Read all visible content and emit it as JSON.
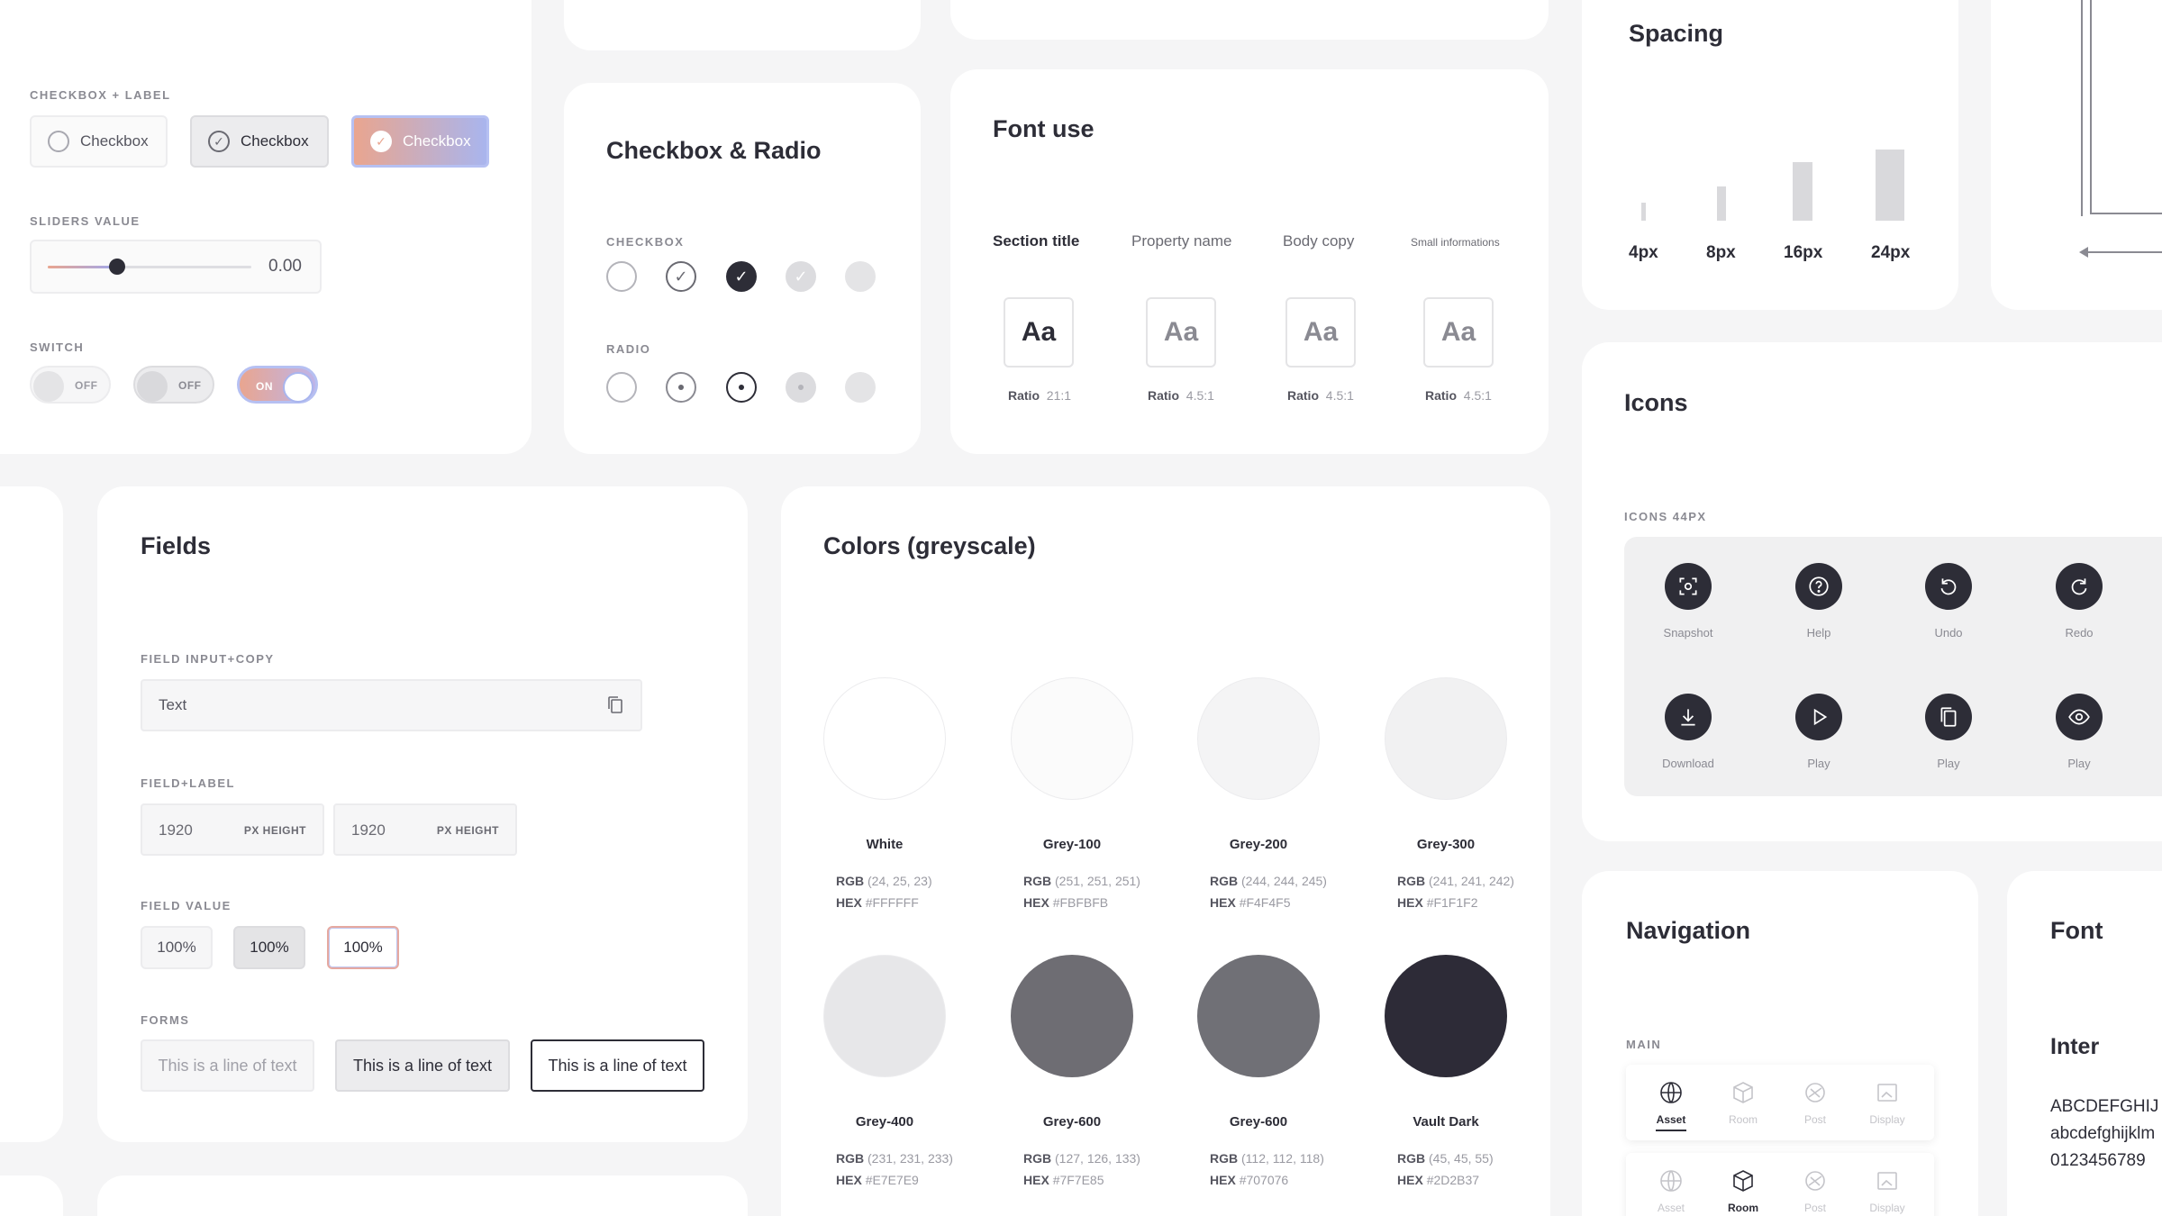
{
  "checkbox_label": {
    "title": "CHECKBOX + LABEL",
    "items": [
      "Checkbox",
      "Checkbox",
      "Checkbox"
    ]
  },
  "slider": {
    "title": "SLIDERS VALUE",
    "value": "0.00",
    "fill_fraction": 0.34
  },
  "switch": {
    "title": "SWITCH",
    "items": [
      "OFF",
      "OFF",
      "ON"
    ]
  },
  "checkbox_radio": {
    "title": "Checkbox & Radio",
    "checkbox_label": "CHECKBOX",
    "radio_label": "RADIO"
  },
  "font_use": {
    "title": "Font use",
    "columns": [
      {
        "head": "Section title",
        "sample": "Aa",
        "ratio_label": "Ratio",
        "ratio": "21:1"
      },
      {
        "head": "Property name",
        "sample": "Aa",
        "ratio_label": "Ratio",
        "ratio": "4.5:1"
      },
      {
        "head": "Body copy",
        "sample": "Aa",
        "ratio_label": "Ratio",
        "ratio": "4.5:1"
      },
      {
        "head": "Small informations",
        "sample": "Aa",
        "ratio_label": "Ratio",
        "ratio": "4.5:1"
      }
    ]
  },
  "spacing": {
    "title": "Spacing",
    "items": [
      "4px",
      "8px",
      "16px",
      "24px"
    ]
  },
  "icons": {
    "title": "Icons",
    "size_label": "ICONS 44PX",
    "items": [
      {
        "label": "Snapshot",
        "icon": "snapshot-icon"
      },
      {
        "label": "Help",
        "icon": "help-icon"
      },
      {
        "label": "Undo",
        "icon": "undo-icon"
      },
      {
        "label": "Redo",
        "icon": "redo-icon"
      },
      {
        "label": "Download",
        "icon": "download-icon"
      },
      {
        "label": "Play",
        "icon": "play-icon"
      },
      {
        "label": "Play",
        "icon": "copy-icon"
      },
      {
        "label": "Play",
        "icon": "eye-icon"
      }
    ]
  },
  "fields": {
    "title": "Fields",
    "input_copy_label": "FIELD INPUT+COPY",
    "input_copy_value": "Text",
    "field_label_label": "FIELD+LABEL",
    "field_label_items": [
      {
        "value": "1920",
        "unit": "PX HEIGHT"
      },
      {
        "value": "1920",
        "unit": "PX HEIGHT"
      }
    ],
    "field_value_label": "FIELD VALUE",
    "field_values": [
      "100%",
      "100%",
      "100%"
    ],
    "forms_label": "FORMS",
    "forms": [
      "This is a line of text",
      "This is a line of text",
      "This is a line of text"
    ]
  },
  "colors": {
    "title": "Colors (greyscale)",
    "swatches": [
      {
        "name": "White",
        "rgb": "(24, 25, 23)",
        "hex": "#FFFFFF",
        "color": "#FFFFFF"
      },
      {
        "name": "Grey-100",
        "rgb": "(251, 251, 251)",
        "hex": "#FBFBFB",
        "color": "#FBFBFB"
      },
      {
        "name": "Grey-200",
        "rgb": "(244, 244, 245)",
        "hex": "#F4F4F5",
        "color": "#F4F4F5"
      },
      {
        "name": "Grey-300",
        "rgb": "(241, 241, 242)",
        "hex": "#F1F1F2",
        "color": "#F1F1F2"
      },
      {
        "name": "Grey-400",
        "rgb": "(231, 231, 233)",
        "hex": "#E7E7E9",
        "color": "#E7E7E9"
      },
      {
        "name": "Grey-600",
        "rgb": "(127, 126, 133)",
        "hex": "#7F7E85",
        "color": "#6E6D73"
      },
      {
        "name": "Grey-600",
        "rgb": "(112, 112, 118)",
        "hex": "#707076",
        "color": "#707076"
      },
      {
        "name": "Vault Dark",
        "rgb": "(45, 45, 55)",
        "hex": "#2D2B37",
        "color": "#2D2B37"
      }
    ],
    "rgb_label": "RGB",
    "hex_label": "HEX"
  },
  "navigation": {
    "title": "Navigation",
    "main_label": "MAIN",
    "bars": [
      {
        "items": [
          "Asset",
          "Room",
          "Post",
          "Display"
        ],
        "active": 0
      },
      {
        "items": [
          "Asset",
          "Room",
          "Post",
          "Display"
        ],
        "active": 1
      }
    ]
  },
  "font": {
    "title": "Font",
    "family": "Inter",
    "upper": "ABCDEFGHIJ",
    "lower": "abcdefghijklm",
    "digits": "0123456789"
  }
}
